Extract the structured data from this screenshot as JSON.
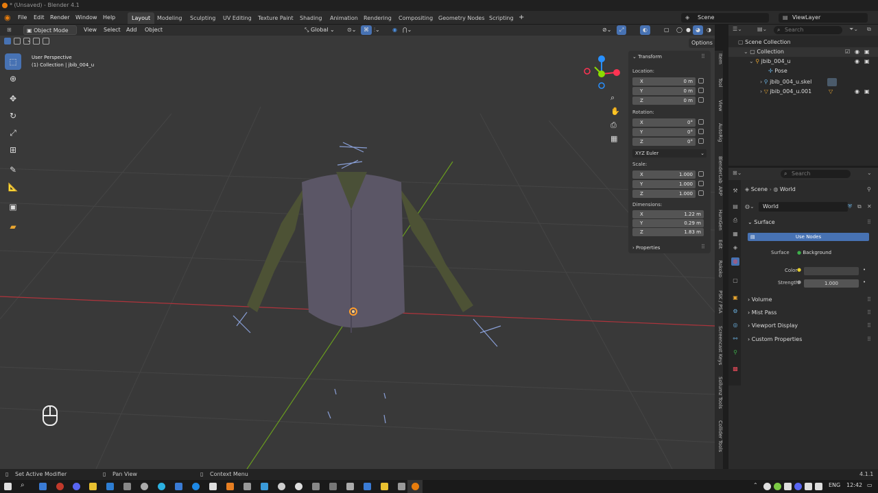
{
  "window": {
    "title": "* (Unsaved) - Blender 4.1"
  },
  "menu": [
    "File",
    "Edit",
    "Render",
    "Window",
    "Help"
  ],
  "workspaces": [
    "Layout",
    "Modeling",
    "Sculpting",
    "UV Editing",
    "Texture Paint",
    "Shading",
    "Animation",
    "Rendering",
    "Compositing",
    "Geometry Nodes",
    "Scripting"
  ],
  "active_workspace": "Layout",
  "add_workspace": "+",
  "scene_field": "Scene",
  "viewlayer_field": "ViewLayer",
  "viewport": {
    "mode": "Object Mode",
    "header_menus": [
      "View",
      "Select",
      "Add",
      "Object"
    ],
    "orientation": "Global",
    "options_label": "Options",
    "overlay_title": "User Perspective",
    "overlay_sub": "(1) Collection | jbib_004_u",
    "gizmo_axes": {
      "x": "X",
      "y": "Y",
      "z": "Z"
    }
  },
  "transform_panel": {
    "header": "Transform",
    "location_label": "Location:",
    "location": [
      {
        "axis": "X",
        "value": "0 m"
      },
      {
        "axis": "Y",
        "value": "0 m"
      },
      {
        "axis": "Z",
        "value": "0 m"
      }
    ],
    "rotation_label": "Rotation:",
    "rotation": [
      {
        "axis": "X",
        "value": "0°"
      },
      {
        "axis": "Y",
        "value": "0°"
      },
      {
        "axis": "Z",
        "value": "0°"
      }
    ],
    "rotation_mode": "XYZ Euler",
    "scale_label": "Scale:",
    "scale": [
      {
        "axis": "X",
        "value": "1.000"
      },
      {
        "axis": "Y",
        "value": "1.000"
      },
      {
        "axis": "Z",
        "value": "1.000"
      }
    ],
    "dimensions_label": "Dimensions:",
    "dimensions": [
      {
        "axis": "X",
        "value": "1.22 m"
      },
      {
        "axis": "Y",
        "value": "0.29 m"
      },
      {
        "axis": "Z",
        "value": "1.83 m"
      }
    ],
    "properties_header": "Properties"
  },
  "sidebar_tabs": [
    "Item",
    "Tool",
    "View",
    "AutoRig",
    "BlenderLab",
    "ARP",
    "HumGen",
    "Edit",
    "Rokoko",
    "PSK / PSA",
    "Screencast Keys",
    "Sollumz Tools",
    "Collider Tools"
  ],
  "outliner": {
    "search_placeholder": "Search",
    "items": [
      {
        "label": "Scene Collection"
      },
      {
        "label": "Collection"
      },
      {
        "label": "jbib_004_u"
      },
      {
        "label": "Pose"
      },
      {
        "label": "jbib_004_u.skel"
      },
      {
        "label": "jbib_004_u.001"
      }
    ]
  },
  "properties": {
    "search_placeholder": "Search",
    "breadcrumb_scene": "Scene",
    "breadcrumb_world": "World",
    "world_name": "World",
    "surface_header": "Surface",
    "use_nodes": "Use Nodes",
    "surface_label": "Surface",
    "surface_value": "Background",
    "color_label": "Color",
    "strength_label": "Strength",
    "strength_value": "1.000",
    "sections": [
      "Volume",
      "Mist Pass",
      "Viewport Display",
      "Custom Properties"
    ]
  },
  "status": {
    "left": "Set Active Modifier",
    "mid": "Pan View",
    "right": "Context Menu",
    "version": "4.1.1"
  },
  "taskbar": {
    "lang": "ENG",
    "time": "12:42"
  },
  "colors": {
    "accent": "#4772b3",
    "axis_x": "#ff3352",
    "axis_y": "#8bdc00",
    "axis_z": "#2890ff",
    "viewport_bg": "#393939"
  }
}
